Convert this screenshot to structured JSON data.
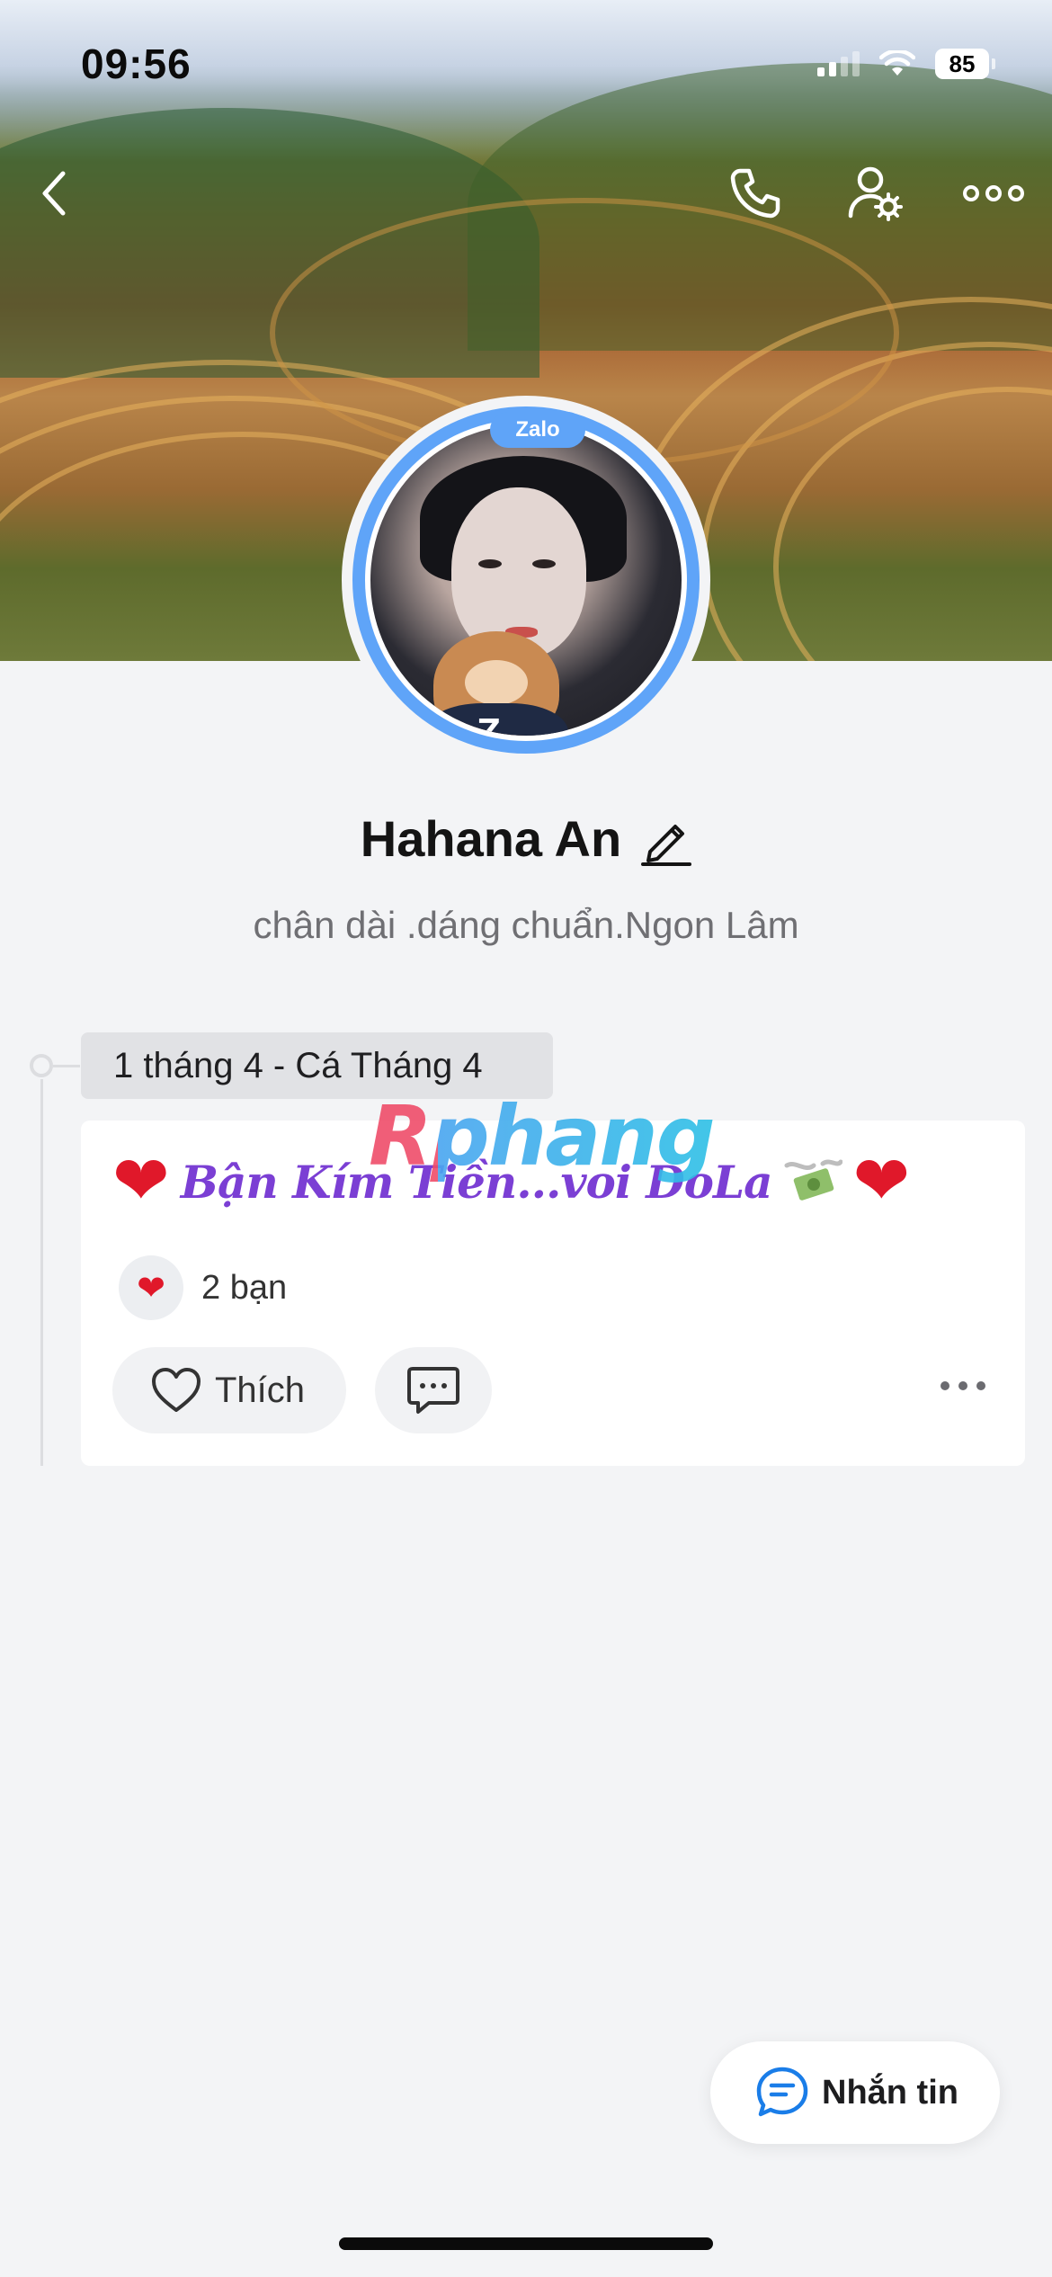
{
  "status_bar": {
    "time": "09:56",
    "battery": "85"
  },
  "profile": {
    "avatar_badge": "Zalo",
    "name": "Hahana An",
    "bio": "chân dài .dáng chuẩn.Ngon Lâm"
  },
  "timeline": {
    "date_label": "1 tháng 4 - Cá Tháng 4",
    "post": {
      "caption": "Bận Kím Tiền...voi DoLa",
      "reaction_count": "2 bạn",
      "like_label": "Thích"
    }
  },
  "watermark": "Rphang",
  "message_button": {
    "label": "Nhắn tin"
  },
  "colors": {
    "accent": "#5fa4f8",
    "heart": "#e0182a",
    "caption": "#7b3fd4"
  }
}
